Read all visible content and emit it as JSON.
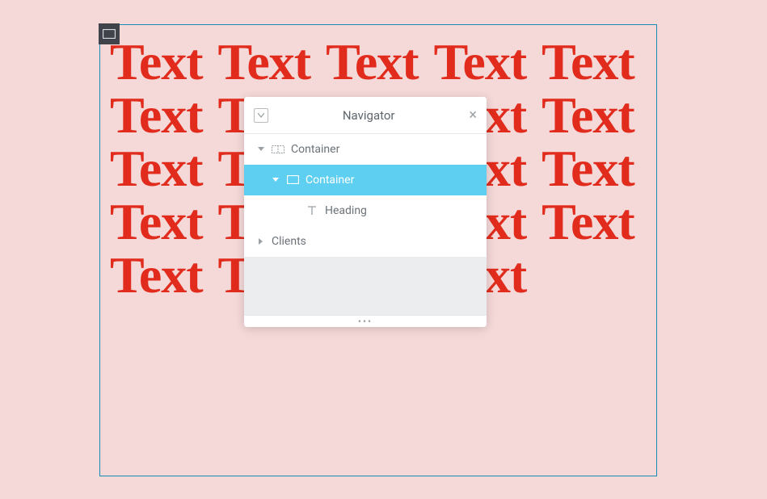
{
  "canvas": {
    "repeated_word": "Text",
    "repeat_count": 24
  },
  "navigator": {
    "title": "Navigator",
    "tree": [
      {
        "label": "Container",
        "level": 0,
        "selected": false,
        "expanded": true,
        "icon": "container-horizontal"
      },
      {
        "label": "Container",
        "level": 1,
        "selected": true,
        "expanded": true,
        "icon": "container"
      },
      {
        "label": "Heading",
        "level": 2,
        "selected": false,
        "expanded": null,
        "icon": "heading"
      },
      {
        "label": "Clients",
        "level": 0,
        "selected": false,
        "expanded": false,
        "icon": null
      }
    ],
    "drag_handle": "•••"
  }
}
